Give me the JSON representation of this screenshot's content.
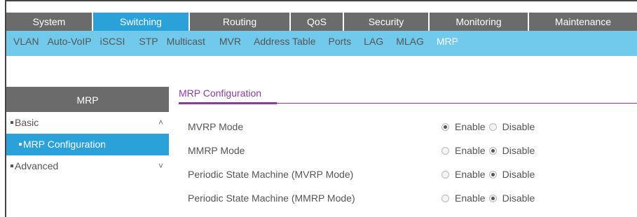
{
  "top_menu": [
    {
      "label": "System",
      "active": false,
      "width": 124
    },
    {
      "label": "Switching",
      "active": true,
      "width": 138
    },
    {
      "label": "Routing",
      "active": false,
      "width": 144
    },
    {
      "label": "QoS",
      "active": false,
      "width": 76
    },
    {
      "label": "Security",
      "active": false,
      "width": 122
    },
    {
      "label": "Monitoring",
      "active": false,
      "width": 142
    },
    {
      "label": "Maintenance",
      "active": false,
      "width": 154
    }
  ],
  "sub_menu": [
    {
      "label": "VLAN",
      "active": false
    },
    {
      "label": "Auto-VoIP",
      "active": false
    },
    {
      "label": "iSCSI",
      "active": false
    },
    {
      "label": "STP",
      "active": false
    },
    {
      "label": "Multicast",
      "active": false
    },
    {
      "label": "MVR",
      "active": false
    },
    {
      "label": "Address Table",
      "active": false
    },
    {
      "label": "Ports",
      "active": false
    },
    {
      "label": "LAG",
      "active": false
    },
    {
      "label": "MLAG",
      "active": false
    },
    {
      "label": "MRP",
      "active": true
    }
  ],
  "left_nav": {
    "title": "MRP",
    "basic": "Basic",
    "mrp_configuration": "MRP Configuration",
    "advanced": "Advanced"
  },
  "main": {
    "title": "MRP Configuration",
    "fields": [
      {
        "label": "MVRP Mode",
        "value": "Enable"
      },
      {
        "label": "MMRP Mode",
        "value": "Disable"
      },
      {
        "label": "Periodic State Machine (MVRP Mode)",
        "value": "Disable"
      },
      {
        "label": "Periodic State Machine (MMRP Mode)",
        "value": "Disable"
      }
    ],
    "enable_label": "Enable",
    "disable_label": "Disable"
  },
  "colors": {
    "accent": "#2aa1d8",
    "submenu_bg": "#71c9ec",
    "menu_bg": "#6b6b6b",
    "title_purple": "#8a3f9f"
  }
}
